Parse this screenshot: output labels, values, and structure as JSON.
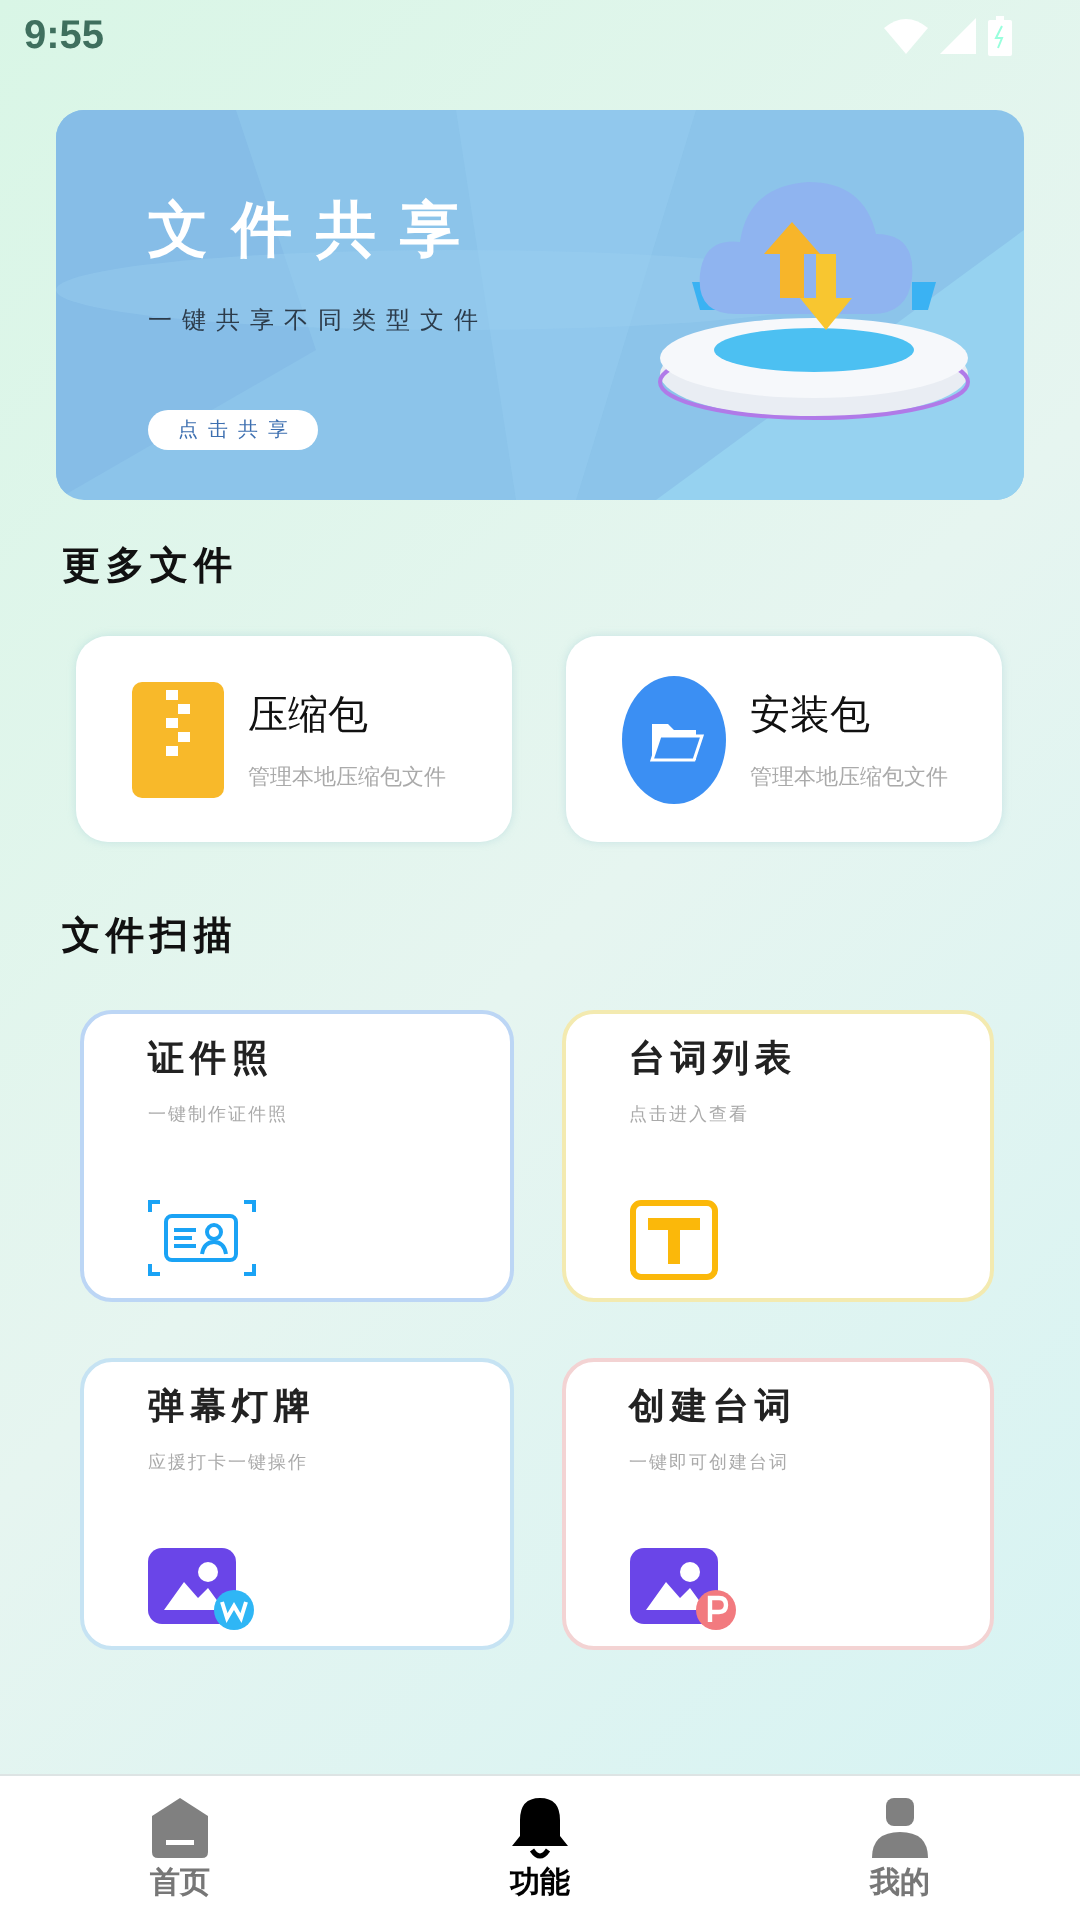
{
  "status_bar": {
    "time": "9:55"
  },
  "banner": {
    "title": "文件共享",
    "subtitle": "一键共享不同类型文件",
    "button": "点击共享"
  },
  "more_files": {
    "title": "更多文件",
    "items": [
      {
        "kind": "zip",
        "title": "压缩包",
        "subtitle": "管理本地压缩包文件"
      },
      {
        "kind": "folder",
        "title": "安装包",
        "subtitle": "管理本地压缩包文件"
      }
    ]
  },
  "file_scan": {
    "title": "文件扫描",
    "items": [
      {
        "kind": "id-card",
        "title": "证件照",
        "subtitle": "一键制作证件照",
        "color": "#bcd6f5"
      },
      {
        "kind": "text",
        "title": "台词列表",
        "subtitle": "点击进入查看",
        "color": "#f3eab0"
      },
      {
        "kind": "image-w",
        "title": "弹幕灯牌",
        "subtitle": "应援打卡一键操作",
        "color": "#c6e3f3"
      },
      {
        "kind": "image-p",
        "title": "创建台词",
        "subtitle": "一键即可创建台词",
        "color": "#f3d3d3"
      }
    ]
  },
  "tabs": [
    {
      "label": "首页",
      "kind": "home",
      "selected": false
    },
    {
      "label": "功能",
      "kind": "bell",
      "selected": true
    },
    {
      "label": "我的",
      "kind": "person",
      "selected": false
    }
  ]
}
